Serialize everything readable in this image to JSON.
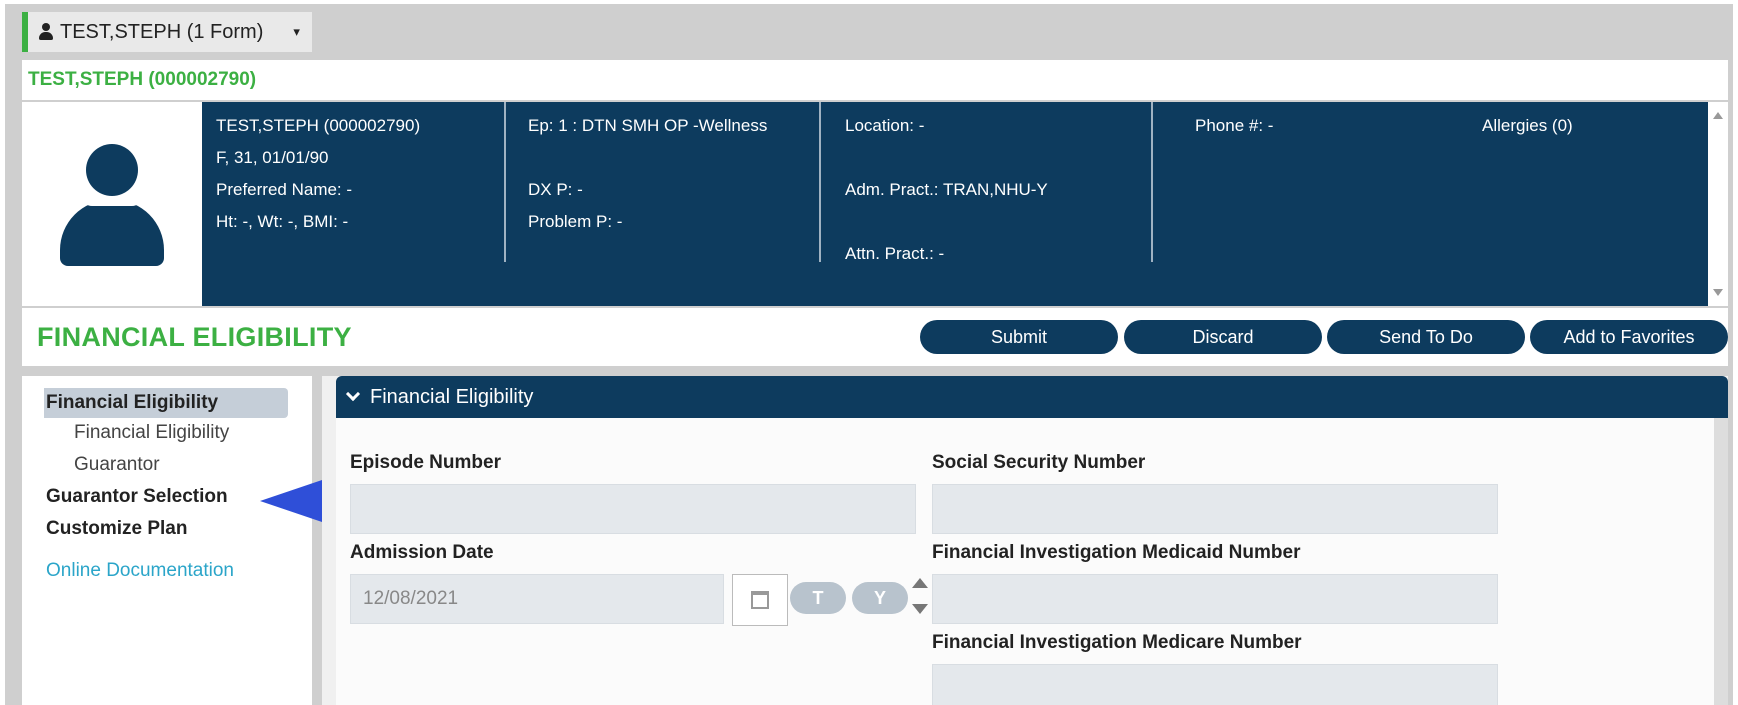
{
  "patient_tab": {
    "label": "TEST,STEPH (1 Form)",
    "caret": "▾"
  },
  "patient_id": "TEST,STEPH (000002790)",
  "banner": {
    "col1": [
      "TEST,STEPH (000002790)",
      "F, 31, 01/01/90",
      "Preferred Name: -",
      "Ht: -, Wt: -, BMI: -"
    ],
    "col2": [
      "Ep: 1 : DTN SMH OP -Wellness",
      "",
      "DX P: -",
      "Problem P: -"
    ],
    "col3": [
      "Location: -",
      "",
      "Adm. Pract.: TRAN,NHU-Y",
      "",
      "Attn. Pract.: -"
    ],
    "phone": "Phone #: -",
    "allergies": "Allergies (0)"
  },
  "page_title": "FINANCIAL ELIGIBILITY",
  "buttons": {
    "submit": "Submit",
    "discard": "Discard",
    "send_to_do": "Send To Do",
    "add_favorites": "Add to Favorites"
  },
  "nav": {
    "active": "Financial Eligibility",
    "sub1": "Financial Eligibility",
    "sub2": "Guarantor",
    "guarantor_selection": "Guarantor Selection",
    "customize_plan": "Customize Plan",
    "online_doc": "Online Documentation"
  },
  "section": {
    "header": "Financial Eligibility",
    "episode_label": "Episode Number",
    "episode_value": "",
    "ssn_label": "Social Security Number",
    "ssn_value": "",
    "admission_label": "Admission Date",
    "admission_value": "12/08/2021",
    "medicaid_label": "Financial Investigation Medicaid Number",
    "medicaid_value": "",
    "medicare_label": "Financial Investigation Medicare Number",
    "today_btn": "T",
    "yesterday_btn": "Y"
  },
  "colors": {
    "navy": "#0d3b5e",
    "green": "#3cb043",
    "arrow": "#2f4fd8",
    "link": "#2ba5c9"
  }
}
